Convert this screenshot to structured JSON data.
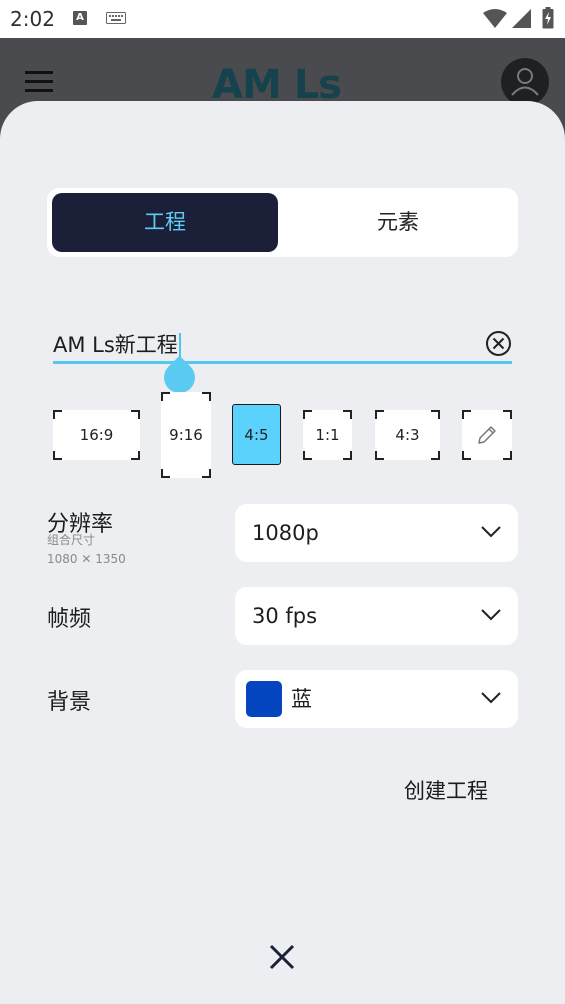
{
  "status_bar": {
    "time": "2:02",
    "notification_letter": "A"
  },
  "app_bar": {
    "logo_text": "AM Ls"
  },
  "tabs": [
    {
      "label": "工程",
      "active": true
    },
    {
      "label": "元素",
      "active": false
    }
  ],
  "project_name": {
    "value": "AM Ls新工程"
  },
  "ratios": [
    {
      "label": "16:9"
    },
    {
      "label": "9:16"
    },
    {
      "label": "4:5",
      "selected": true
    },
    {
      "label": "1:1"
    },
    {
      "label": "4:3"
    }
  ],
  "resolution": {
    "label": "分辨率",
    "sub_label": "组合尺寸",
    "size_text": "1080 ✕ 1350",
    "value": "1080p"
  },
  "frame_rate": {
    "label": "帧频",
    "value": "30 fps"
  },
  "background": {
    "label": "背景",
    "value": "蓝",
    "swatch_color": "#0645c0"
  },
  "actions": {
    "create_label": "创建工程"
  },
  "colors": {
    "accent": "#5ecdf3",
    "tab_active_bg": "#1b2038",
    "sheet_bg": "#eceef1"
  }
}
